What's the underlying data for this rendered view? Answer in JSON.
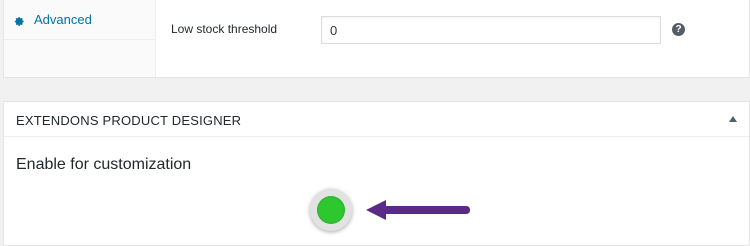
{
  "sidebar": {
    "items": [
      {
        "label": "Advanced",
        "icon": "gear-icon"
      }
    ]
  },
  "inventory": {
    "low_stock_label": "Low stock threshold",
    "low_stock_value": "0",
    "help_icon": "question-icon",
    "help_glyph": "?"
  },
  "product_designer": {
    "title": "EXTENDONS PRODUCT DESIGNER",
    "heading": "Enable for customization",
    "toggle_color": "#2fc72f",
    "arrow_color": "#5b2a86",
    "enabled": true
  }
}
